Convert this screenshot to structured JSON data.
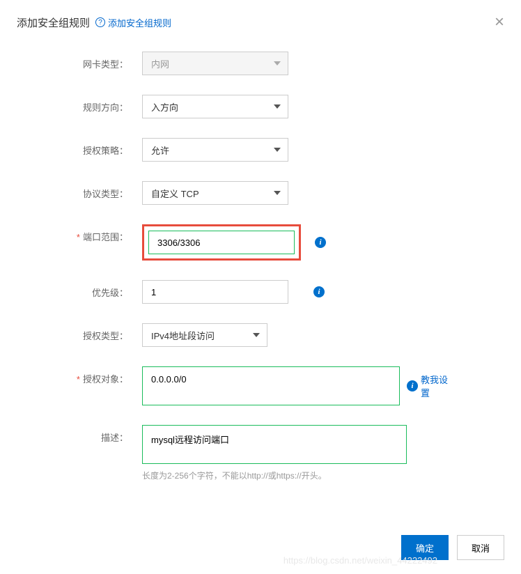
{
  "dialog": {
    "title": "添加安全组规则",
    "subtitle": "添加安全组规则"
  },
  "form": {
    "nic_type": {
      "label": "网卡类型：",
      "value": "内网"
    },
    "direction": {
      "label": "规则方向：",
      "value": "入方向"
    },
    "policy": {
      "label": "授权策略：",
      "value": "允许"
    },
    "protocol": {
      "label": "协议类型：",
      "value": "自定义 TCP"
    },
    "port_range": {
      "label": "端口范围：",
      "value": "3306/3306"
    },
    "priority": {
      "label": "优先级：",
      "value": "1"
    },
    "auth_type": {
      "label": "授权类型：",
      "value": "IPv4地址段访问"
    },
    "auth_object": {
      "label": "授权对象：",
      "value": "0.0.0.0/0",
      "help_link": "教我设置"
    },
    "description": {
      "label": "描述：",
      "value": "mysql远程访问端口",
      "hint": "长度为2-256个字符，不能以http://或https://开头。"
    }
  },
  "buttons": {
    "confirm": "确定",
    "cancel": "取消"
  },
  "watermark": "https://blog.csdn.net/weixin_44222492"
}
